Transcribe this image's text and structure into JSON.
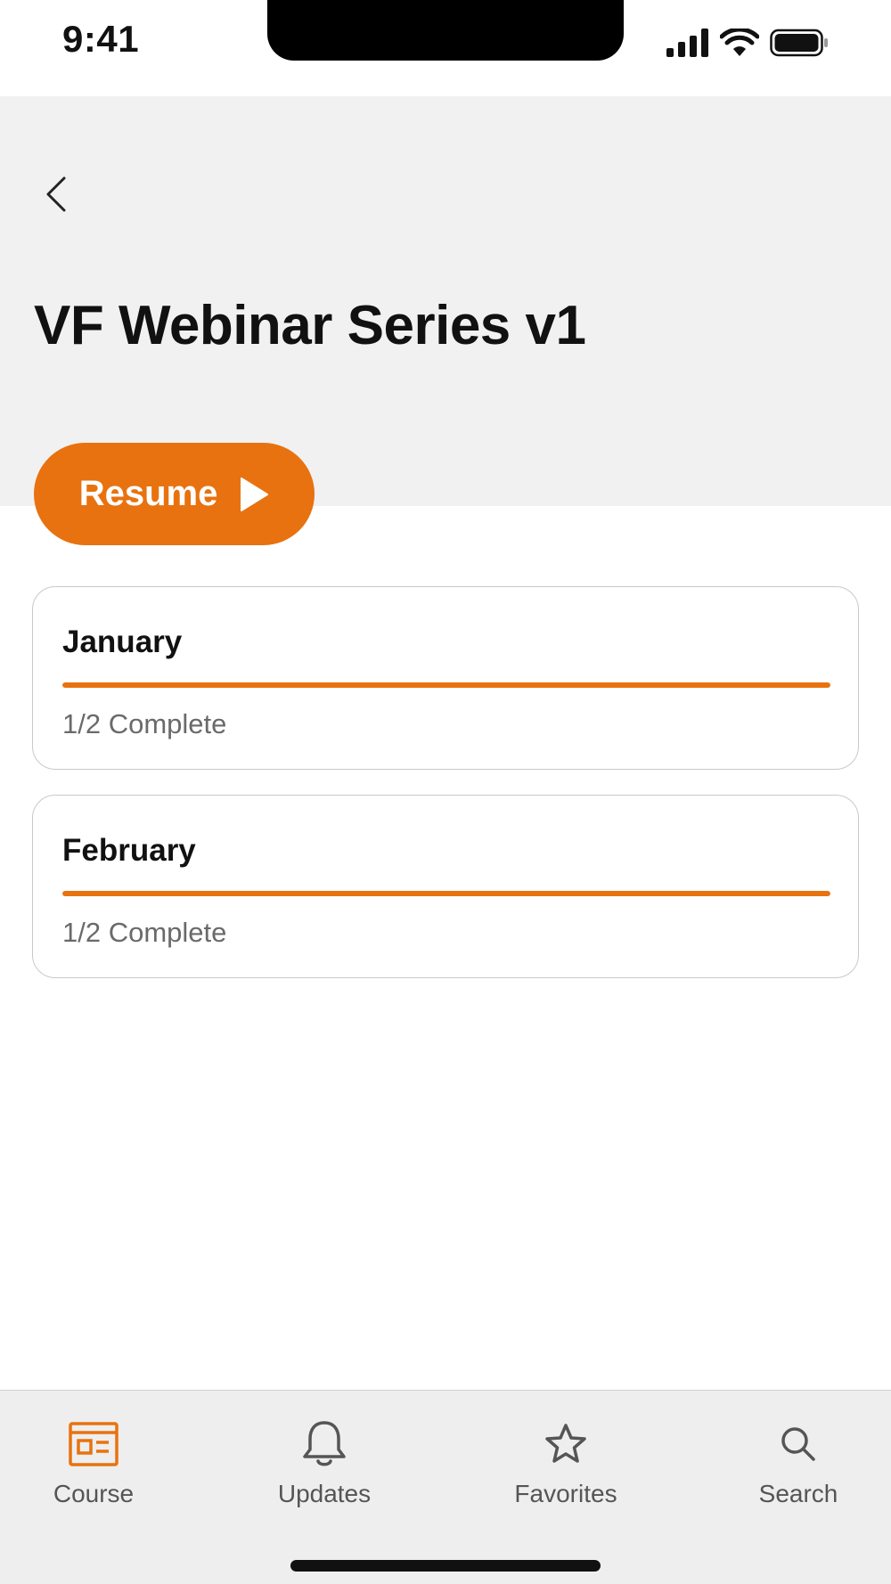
{
  "status_bar": {
    "time": "9:41",
    "icons": [
      "signal-icon",
      "wifi-icon",
      "battery-icon"
    ]
  },
  "header": {
    "back_icon": "chevron-left-icon",
    "title": "VF Webinar Series v1"
  },
  "resume_button": {
    "label": "Resume",
    "icon": "play-icon"
  },
  "modules": [
    {
      "title": "January",
      "status": "1/2 Complete",
      "progress": 1.0
    },
    {
      "title": "February",
      "status": "1/2 Complete",
      "progress": 1.0
    }
  ],
  "tab_bar": {
    "items": [
      {
        "label": "Course",
        "icon": "course-icon",
        "active": true
      },
      {
        "label": "Updates",
        "icon": "bell-icon",
        "active": false
      },
      {
        "label": "Favorites",
        "icon": "star-icon",
        "active": false
      },
      {
        "label": "Search",
        "icon": "search-icon",
        "active": false
      }
    ]
  },
  "colors": {
    "accent": "#e8720f",
    "header_bg": "#f1f1f1",
    "tab_bar_bg": "#eeeeee",
    "inactive_icon": "#555555"
  }
}
